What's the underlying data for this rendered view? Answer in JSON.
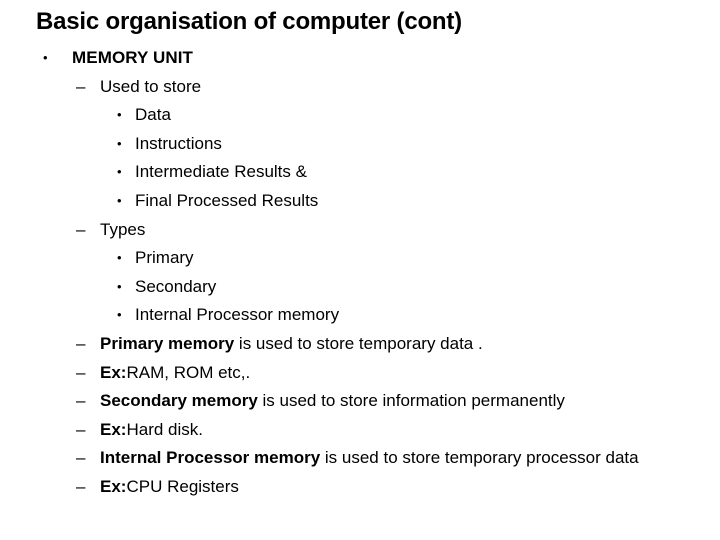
{
  "slide": {
    "title": "Basic organisation of computer (cont)",
    "bullet_glyphs": {
      "round": "•",
      "dash": "–"
    },
    "colors": {
      "text": "#000000",
      "background": "#ffffff"
    },
    "lines": [
      {
        "level": 1,
        "bullet": "round",
        "text": "MEMORY UNIT",
        "bold": true
      },
      {
        "level": 2,
        "bullet": "dash",
        "text": "Used to store",
        "bold": false
      },
      {
        "level": 3,
        "bullet": "round",
        "text": "Data",
        "bold": false
      },
      {
        "level": 3,
        "bullet": "round",
        "text": "Instructions",
        "bold": false
      },
      {
        "level": 3,
        "bullet": "round",
        "text": "Intermediate Results &",
        "bold": false
      },
      {
        "level": 3,
        "bullet": "round",
        "text": "Final Processed Results",
        "bold": false
      },
      {
        "level": 2,
        "bullet": "dash",
        "text": "Types",
        "bold": false
      },
      {
        "level": 3,
        "bullet": "round",
        "text": "Primary",
        "bold": false
      },
      {
        "level": 3,
        "bullet": "round",
        "text": "Secondary",
        "bold": false
      },
      {
        "level": 3,
        "bullet": "round",
        "text": "Internal Processor memory",
        "bold": false
      },
      {
        "level": 2,
        "bullet": "dash",
        "bold_part": "Primary memory",
        "rest": " is used to store temporary data ."
      },
      {
        "level": 2,
        "bullet": "dash",
        "bold_part": "Ex:",
        "rest": "RAM, ROM etc,."
      },
      {
        "level": 2,
        "bullet": "dash",
        "bold_part": "Secondary memory",
        "rest": " is used to store information permanently"
      },
      {
        "level": 2,
        "bullet": "dash",
        "bold_part": "Ex:",
        "rest": "Hard disk."
      },
      {
        "level": 2,
        "bullet": "dash",
        "bold_part": "Internal Processor memory",
        "rest": " is used to store temporary processor data"
      },
      {
        "level": 2,
        "bullet": "dash",
        "bold_part": "Ex:",
        "rest": "CPU Registers"
      }
    ]
  }
}
